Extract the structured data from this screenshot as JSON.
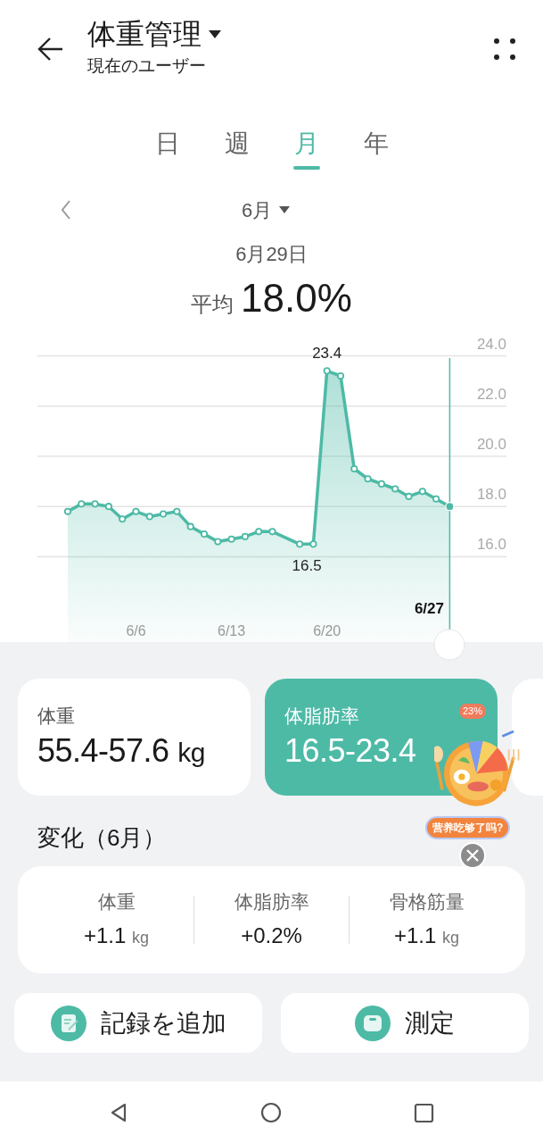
{
  "header": {
    "title": "体重管理",
    "subtitle": "現在のユーザー"
  },
  "tabs": [
    {
      "label": "日",
      "selected": false
    },
    {
      "label": "週",
      "selected": false
    },
    {
      "label": "月",
      "selected": true
    },
    {
      "label": "年",
      "selected": false
    }
  ],
  "period": {
    "label": "6月"
  },
  "selected_date": "6月29日",
  "average": {
    "label": "平均",
    "value": "18.0%"
  },
  "chart": {
    "chart_data": {
      "type": "area",
      "categories": [
        null,
        null,
        null,
        null,
        null,
        "6/6",
        null,
        null,
        null,
        null,
        null,
        null,
        "6/13",
        null,
        null,
        null,
        null,
        null,
        null,
        "6/20",
        null,
        null,
        null,
        null,
        null,
        null,
        null,
        null,
        null
      ],
      "values": [
        17.8,
        18.1,
        18.1,
        18.0,
        17.5,
        17.8,
        17.6,
        17.7,
        17.8,
        17.2,
        16.9,
        16.6,
        16.7,
        16.8,
        17.0,
        17.0,
        null,
        16.5,
        16.5,
        23.4,
        23.2,
        19.5,
        19.1,
        18.9,
        18.7,
        18.4,
        18.6,
        18.3,
        18.0
      ],
      "ylim": [
        12.6,
        24
      ],
      "grid": true,
      "yticks": [
        {
          "value": 16,
          "label": "16.0"
        },
        {
          "value": 18,
          "label": "18.0"
        },
        {
          "value": 20,
          "label": "20.0"
        },
        {
          "value": 22,
          "label": "22.0"
        },
        {
          "value": 24,
          "label": "24.0"
        }
      ],
      "annotations": [
        {
          "x": "6/20",
          "y": 23.4,
          "text": "23.4"
        },
        "16.5",
        "6/27"
      ]
    }
  },
  "metric_cards": [
    {
      "label": "体重",
      "value": "55.4-57.6",
      "unit": "kg",
      "selected": false
    },
    {
      "label": "体脂肪率",
      "value": "16.5-23.4",
      "selected": true
    }
  ],
  "more_cards": true,
  "promo": {
    "bubble": "23%",
    "caption": "营养吃够了吗?"
  },
  "change": {
    "title": "変化（6月）",
    "items": [
      {
        "label": "体重",
        "value": "+1.1",
        "unit": "kg"
      },
      {
        "label": "体脂肪率",
        "value": "+0.2%"
      },
      {
        "label": "骨格筋量",
        "value": "+1.1",
        "unit": "kg"
      }
    ]
  },
  "actions": [
    {
      "label": "記録を追加",
      "kind": "record"
    },
    {
      "label": "測定",
      "kind": "measure"
    }
  ]
}
